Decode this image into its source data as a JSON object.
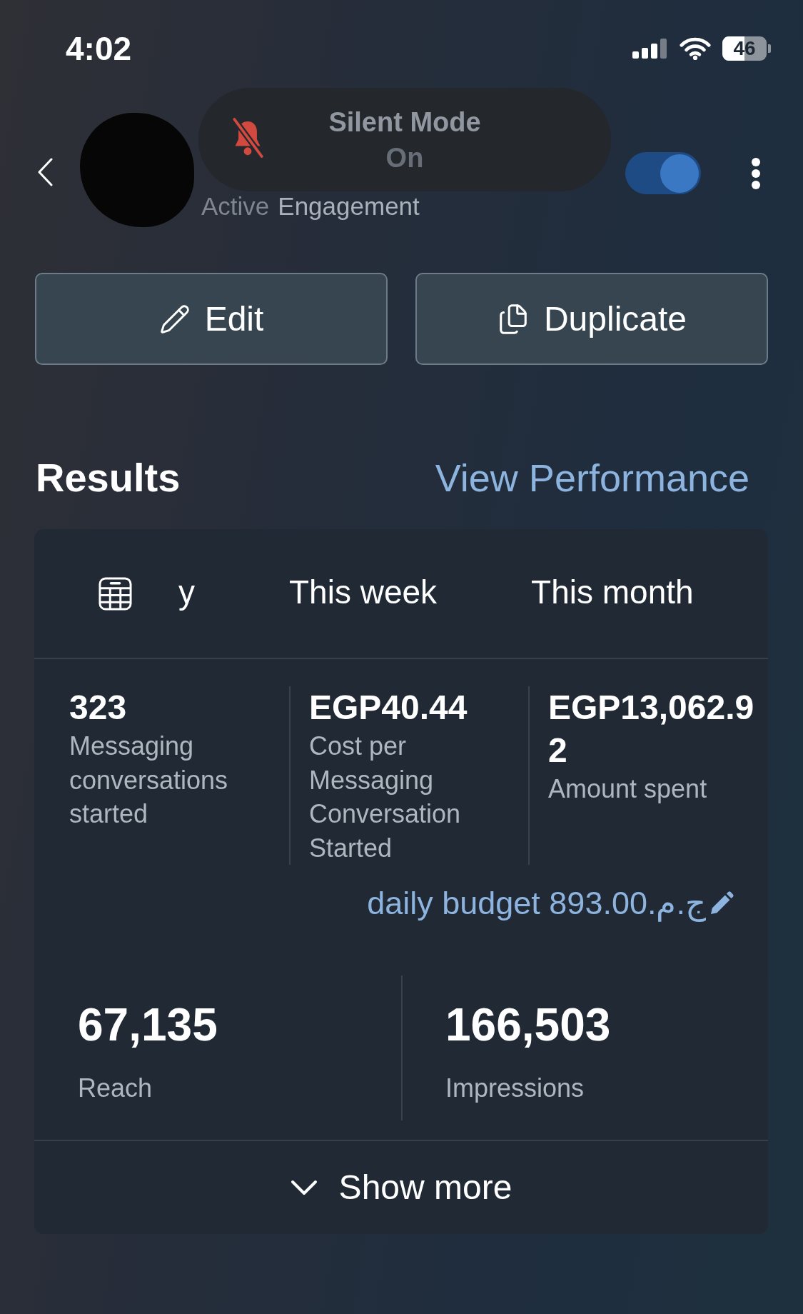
{
  "status_bar": {
    "time": "4:02",
    "battery": "46"
  },
  "silent_mode_banner": {
    "title": "Silent Mode",
    "state": "On"
  },
  "header": {
    "status": "Active",
    "objective": "Engagement",
    "toggle": {
      "on": true
    }
  },
  "actions": [
    {
      "kind": "edit",
      "label": "Edit"
    },
    {
      "kind": "duplicate",
      "label": "Duplicate"
    }
  ],
  "results": {
    "title": "Results",
    "link": "View Performance",
    "tabs": [
      {
        "label": "y",
        "selected": false
      },
      {
        "label": "This week",
        "selected": false
      },
      {
        "label": "This month",
        "selected": false
      }
    ],
    "metrics": [
      {
        "value": "323",
        "label": "Messaging conversations started"
      },
      {
        "value": "EGP40.44",
        "label": "Cost per Messaging Conversation Started"
      },
      {
        "value": "EGP13,062.92",
        "label": "Amount spent"
      }
    ],
    "daily_budget": "daily budget 893.00.ج.م",
    "totals": [
      {
        "value": "67,135",
        "label": "Reach"
      },
      {
        "value": "166,503",
        "label": "Impressions"
      }
    ],
    "show_more": "Show more"
  }
}
